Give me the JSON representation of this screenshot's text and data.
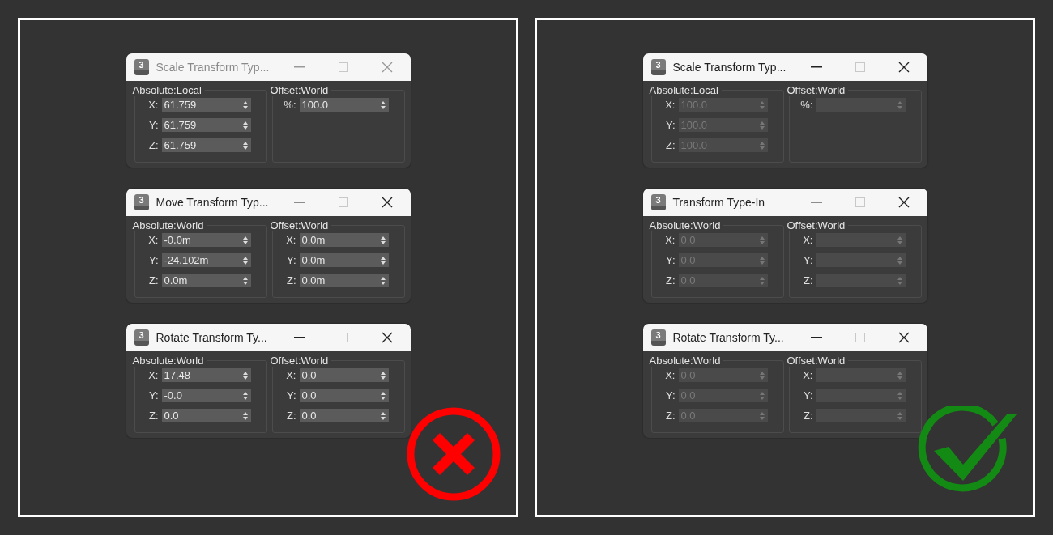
{
  "panels": [
    {
      "kind": "wrong",
      "dialogs": [
        {
          "badge": "3",
          "title": "Scale Transform Typ...",
          "active": false,
          "groups": [
            {
              "label": "Absolute:Local",
              "fields": [
                {
                  "label": "X:",
                  "value": "61.759",
                  "disabled": false
                },
                {
                  "label": "Y:",
                  "value": "61.759",
                  "disabled": false
                },
                {
                  "label": "Z:",
                  "value": "61.759",
                  "disabled": false
                }
              ]
            },
            {
              "label": "Offset:World",
              "fields": [
                {
                  "label": "%:",
                  "value": "100.0",
                  "disabled": false
                }
              ]
            }
          ]
        },
        {
          "badge": "3",
          "title": "Move Transform Typ...",
          "active": true,
          "groups": [
            {
              "label": "Absolute:World",
              "fields": [
                {
                  "label": "X:",
                  "value": "-0.0m",
                  "disabled": false
                },
                {
                  "label": "Y:",
                  "value": "-24.102m",
                  "disabled": false
                },
                {
                  "label": "Z:",
                  "value": "0.0m",
                  "disabled": false
                }
              ]
            },
            {
              "label": "Offset:World",
              "fields": [
                {
                  "label": "X:",
                  "value": "0.0m",
                  "disabled": false
                },
                {
                  "label": "Y:",
                  "value": "0.0m",
                  "disabled": false
                },
                {
                  "label": "Z:",
                  "value": "0.0m",
                  "disabled": false
                }
              ]
            }
          ]
        },
        {
          "badge": "3",
          "title": "Rotate Transform Ty...",
          "active": true,
          "groups": [
            {
              "label": "Absolute:World",
              "fields": [
                {
                  "label": "X:",
                  "value": "17.48",
                  "disabled": false
                },
                {
                  "label": "Y:",
                  "value": "-0.0",
                  "disabled": false
                },
                {
                  "label": "Z:",
                  "value": "0.0",
                  "disabled": false
                }
              ]
            },
            {
              "label": "Offset:World",
              "fields": [
                {
                  "label": "X:",
                  "value": "0.0",
                  "disabled": false
                },
                {
                  "label": "Y:",
                  "value": "0.0",
                  "disabled": false
                },
                {
                  "label": "Z:",
                  "value": "0.0",
                  "disabled": false
                }
              ]
            }
          ]
        }
      ]
    },
    {
      "kind": "right",
      "dialogs": [
        {
          "badge": "3",
          "title": "Scale Transform Typ...",
          "active": true,
          "groups": [
            {
              "label": "Absolute:Local",
              "fields": [
                {
                  "label": "X:",
                  "value": "100.0",
                  "disabled": true
                },
                {
                  "label": "Y:",
                  "value": "100.0",
                  "disabled": true
                },
                {
                  "label": "Z:",
                  "value": "100.0",
                  "disabled": true
                }
              ]
            },
            {
              "label": "Offset:World",
              "fields": [
                {
                  "label": "%:",
                  "disabled": true
                }
              ]
            }
          ]
        },
        {
          "badge": "3",
          "title": "Transform Type-In",
          "active": true,
          "groups": [
            {
              "label": "Absolute:World",
              "fields": [
                {
                  "label": "X:",
                  "value": "0.0",
                  "disabled": true
                },
                {
                  "label": "Y:",
                  "value": "0.0",
                  "disabled": true
                },
                {
                  "label": "Z:",
                  "value": "0.0",
                  "disabled": true
                }
              ]
            },
            {
              "label": "Offset:World",
              "fields": [
                {
                  "label": "X:",
                  "disabled": true
                },
                {
                  "label": "Y:",
                  "disabled": true
                },
                {
                  "label": "Z:",
                  "disabled": true
                }
              ]
            }
          ]
        },
        {
          "badge": "3",
          "title": "Rotate Transform Ty...",
          "active": true,
          "groups": [
            {
              "label": "Absolute:World",
              "fields": [
                {
                  "label": "X:",
                  "value": "0.0",
                  "disabled": true
                },
                {
                  "label": "Y:",
                  "value": "0.0",
                  "disabled": true
                },
                {
                  "label": "Z:",
                  "value": "0.0",
                  "disabled": true
                }
              ]
            },
            {
              "label": "Offset:World",
              "fields": [
                {
                  "label": "X:",
                  "disabled": true
                },
                {
                  "label": "Y:",
                  "disabled": true
                },
                {
                  "label": "Z:",
                  "disabled": true
                }
              ]
            }
          ]
        }
      ]
    }
  ]
}
